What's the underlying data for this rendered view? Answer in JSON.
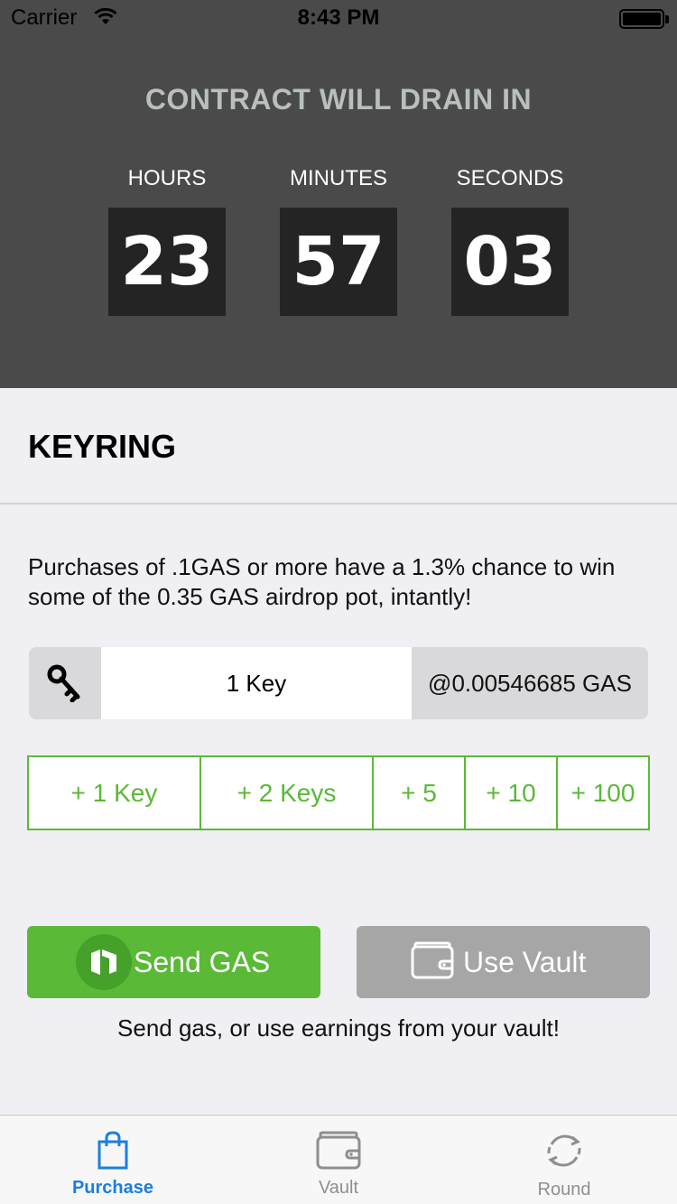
{
  "status_bar": {
    "carrier": "Carrier",
    "time": "8:43 PM"
  },
  "countdown": {
    "title": "CONTRACT WILL DRAIN IN",
    "hours_label": "HOURS",
    "hours_value": "23",
    "minutes_label": "MINUTES",
    "minutes_value": "57",
    "seconds_label": "SECONDS",
    "seconds_value": "03"
  },
  "keyring": {
    "title": "KEYRING",
    "info": "Purchases of .1GAS or more have a 1.3% chance to win some of the 0.35 GAS airdrop pot, intantly!",
    "key_input_value": "1 Key",
    "price": "@0.00546685 GAS",
    "key_icon": "key-icon",
    "adders": [
      "+ 1 Key",
      "+ 2 Keys",
      "+ 5",
      "+ 10",
      "+ 100"
    ]
  },
  "actions": {
    "send_label": "Send GAS",
    "send_icon": "neo-logo-icon",
    "vault_label": "Use Vault",
    "vault_icon": "wallet-icon",
    "hint": "Send gas, or use earnings from your vault!"
  },
  "tabs": [
    {
      "label": "Purchase",
      "icon": "shopping-bag-icon",
      "active": true
    },
    {
      "label": "Vault",
      "icon": "wallet-icon",
      "active": false
    },
    {
      "label": "Round",
      "icon": "refresh-icon",
      "active": false
    }
  ],
  "colors": {
    "accent_green": "#5ab937",
    "tab_active": "#1a7fe0",
    "header_bg": "#4a4a4a"
  }
}
